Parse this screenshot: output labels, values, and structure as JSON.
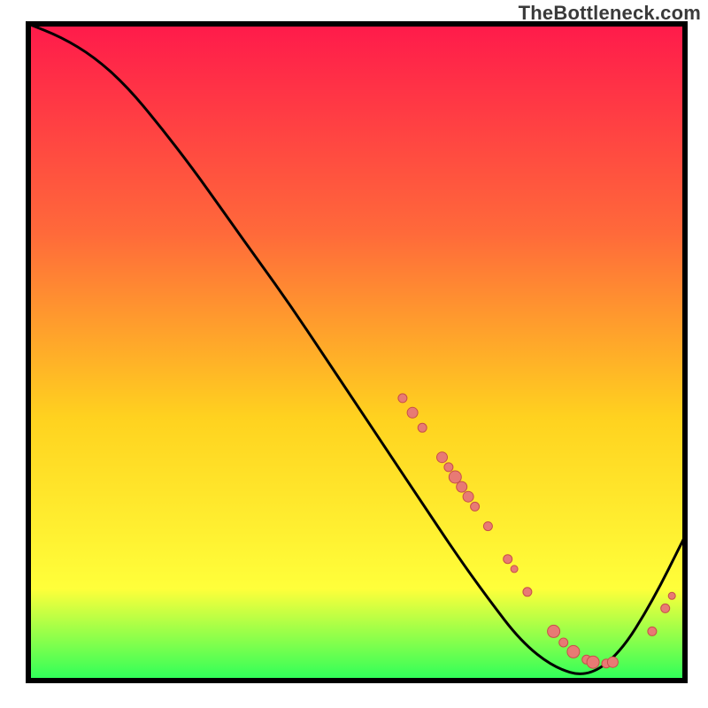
{
  "watermark": "TheBottleneck.com",
  "colors": {
    "gradient_top": "#ff1a4b",
    "gradient_mid1": "#ff6a3a",
    "gradient_mid2": "#ffd21f",
    "gradient_mid3": "#ffff3a",
    "gradient_bottom": "#2bff5a",
    "frame": "#000000",
    "curve": "#000000",
    "dot_fill": "#e87a74",
    "dot_stroke": "#c74f49"
  },
  "chart_data": {
    "type": "line",
    "title": "",
    "xlabel": "",
    "ylabel": "",
    "xlim": [
      0,
      100
    ],
    "ylim": [
      0,
      100
    ],
    "x": [
      0,
      5,
      10,
      15,
      20,
      25,
      30,
      35,
      40,
      45,
      50,
      55,
      60,
      65,
      70,
      75,
      80,
      85,
      90,
      95,
      100
    ],
    "curve_y": [
      100,
      98,
      95,
      90.5,
      84.5,
      78,
      71,
      64,
      57,
      49.5,
      42,
      34.5,
      27,
      19.5,
      12.5,
      6,
      2,
      0.5,
      4,
      12,
      22
    ],
    "dots": [
      {
        "x": 57,
        "y": 43,
        "r": 5
      },
      {
        "x": 58.5,
        "y": 40.8,
        "r": 6
      },
      {
        "x": 60,
        "y": 38.5,
        "r": 5
      },
      {
        "x": 63,
        "y": 34,
        "r": 6
      },
      {
        "x": 64,
        "y": 32.5,
        "r": 5
      },
      {
        "x": 65,
        "y": 31,
        "r": 7
      },
      {
        "x": 66,
        "y": 29.5,
        "r": 6
      },
      {
        "x": 67,
        "y": 28,
        "r": 6
      },
      {
        "x": 68,
        "y": 26.5,
        "r": 5
      },
      {
        "x": 70,
        "y": 23.5,
        "r": 5
      },
      {
        "x": 73,
        "y": 18.5,
        "r": 5
      },
      {
        "x": 74,
        "y": 17,
        "r": 4
      },
      {
        "x": 76,
        "y": 13.5,
        "r": 5
      },
      {
        "x": 80,
        "y": 7.5,
        "r": 7
      },
      {
        "x": 81.5,
        "y": 5.8,
        "r": 5
      },
      {
        "x": 83,
        "y": 4.4,
        "r": 7
      },
      {
        "x": 85,
        "y": 3.2,
        "r": 5
      },
      {
        "x": 86,
        "y": 2.8,
        "r": 7
      },
      {
        "x": 88,
        "y": 2.6,
        "r": 5
      },
      {
        "x": 89,
        "y": 2.8,
        "r": 6
      },
      {
        "x": 95,
        "y": 7.5,
        "r": 5
      },
      {
        "x": 97,
        "y": 11,
        "r": 5
      },
      {
        "x": 98,
        "y": 12.9,
        "r": 4
      }
    ],
    "grid": false,
    "legend": null
  }
}
